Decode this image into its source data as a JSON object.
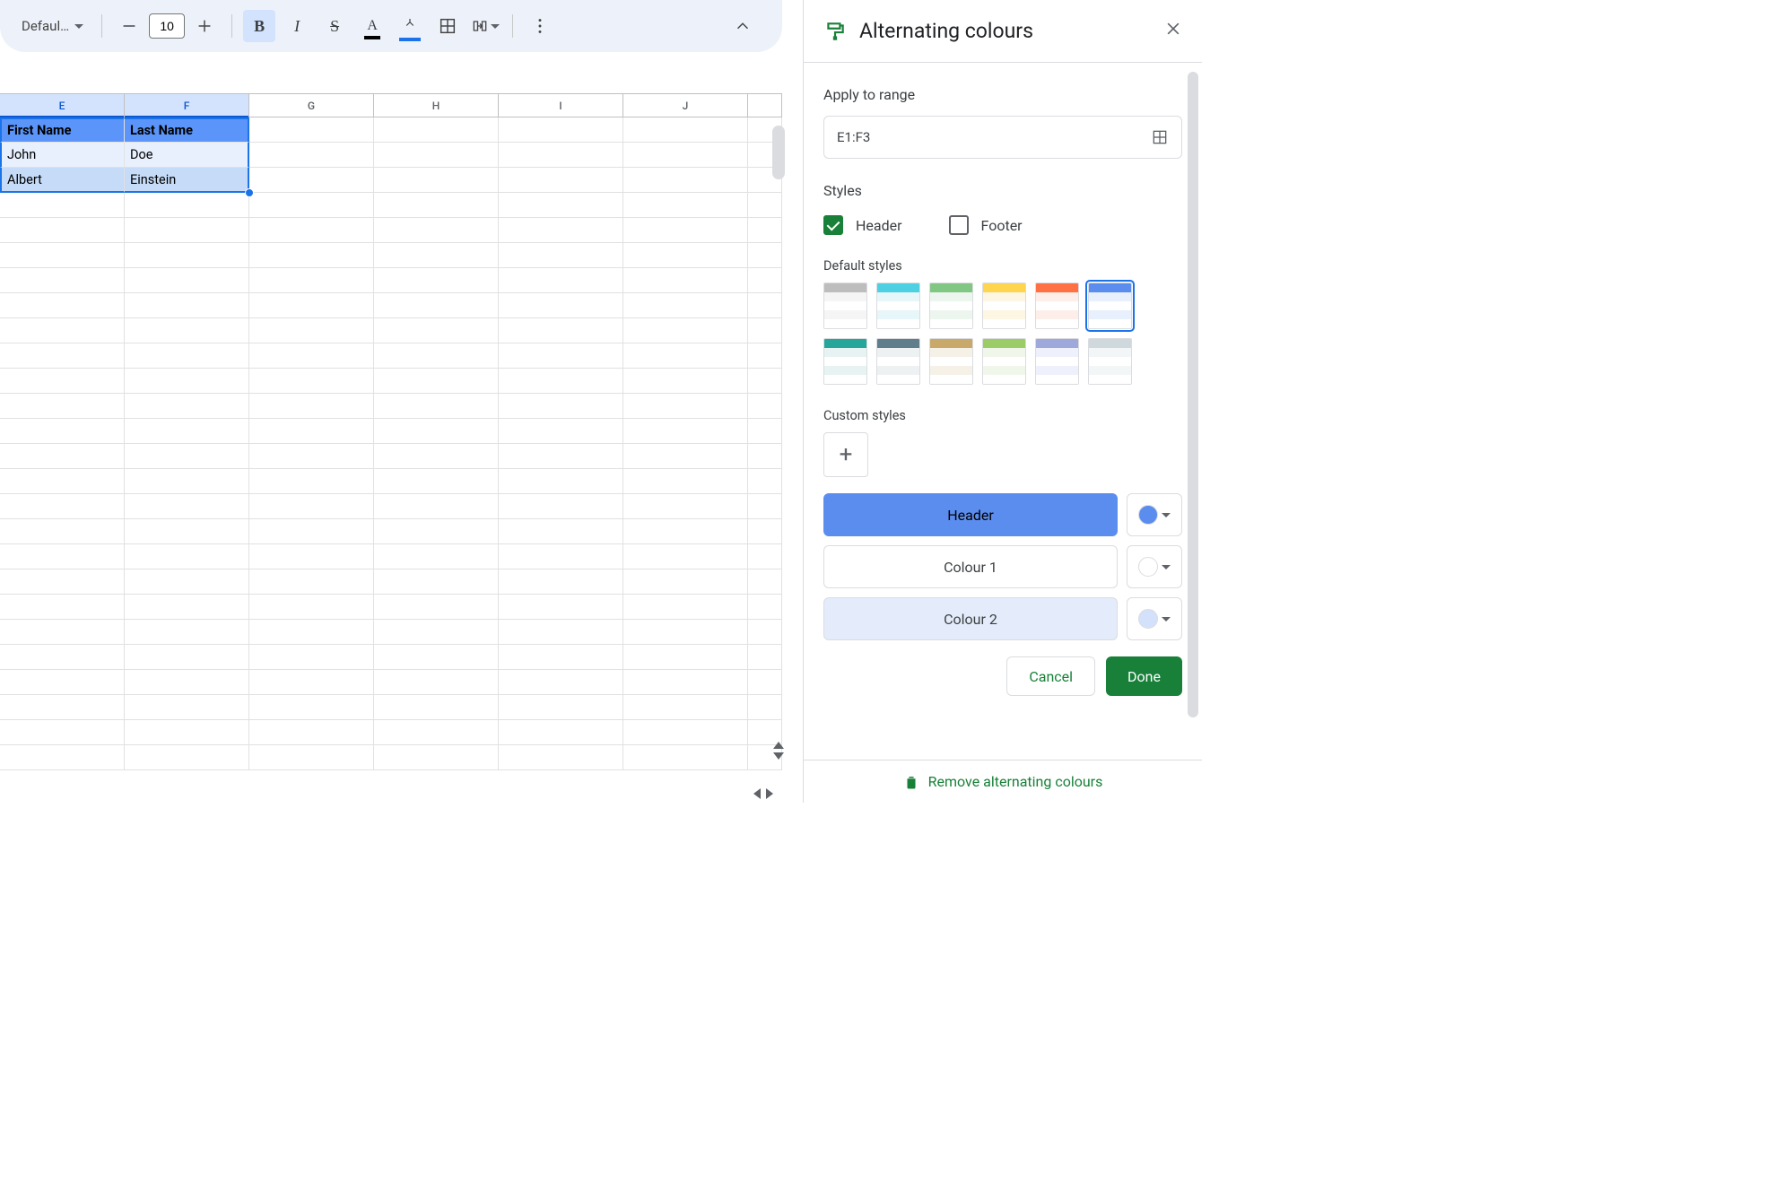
{
  "toolbar": {
    "font_name": "Defaul…",
    "font_size": "10"
  },
  "columns": [
    "E",
    "F",
    "G",
    "H",
    "I",
    "J",
    ""
  ],
  "data": {
    "r1": {
      "E": "First Name",
      "F": "Last Name"
    },
    "r2": {
      "E": "John",
      "F": "Doe"
    },
    "r3": {
      "E": "Albert",
      "F": "Einstein"
    }
  },
  "panel": {
    "title": "Alternating colours",
    "apply_label": "Apply to range",
    "range": "E1:F3",
    "styles_label": "Styles",
    "header_check": "Header",
    "footer_check": "Footer",
    "default_styles_label": "Default styles",
    "custom_styles_label": "Custom styles",
    "rows": {
      "header": "Header",
      "c1": "Colour 1",
      "c2": "Colour 2"
    },
    "colors": {
      "header": "#5b8def",
      "c1": "#ffffff",
      "c2": "#d3e1fb"
    },
    "cancel": "Cancel",
    "done": "Done",
    "remove": "Remove alternating colours"
  },
  "default_palettes": [
    {
      "h": "#bdbdbd",
      "a": "#f5f5f5",
      "b": "#ffffff"
    },
    {
      "h": "#4dd0e1",
      "a": "#e7f6f8",
      "b": "#ffffff"
    },
    {
      "h": "#81c784",
      "a": "#edf6ee",
      "b": "#ffffff"
    },
    {
      "h": "#ffd54f",
      "a": "#fdf6e3",
      "b": "#ffffff"
    },
    {
      "h": "#ff7043",
      "a": "#fdeee9",
      "b": "#ffffff"
    },
    {
      "h": "#5b8def",
      "a": "#e8f0fe",
      "b": "#ffffff"
    },
    {
      "h": "#26a69a",
      "a": "#e6f3f2",
      "b": "#ffffff"
    },
    {
      "h": "#607d8b",
      "a": "#eef1f2",
      "b": "#ffffff"
    },
    {
      "h": "#c9a96a",
      "a": "#f6f1e7",
      "b": "#ffffff"
    },
    {
      "h": "#9ccc65",
      "a": "#f0f7ea",
      "b": "#ffffff"
    },
    {
      "h": "#9fa8da",
      "a": "#eef0fb",
      "b": "#ffffff"
    },
    {
      "h": "#cfd8dc",
      "a": "#f3f6f7",
      "b": "#ffffff"
    }
  ]
}
